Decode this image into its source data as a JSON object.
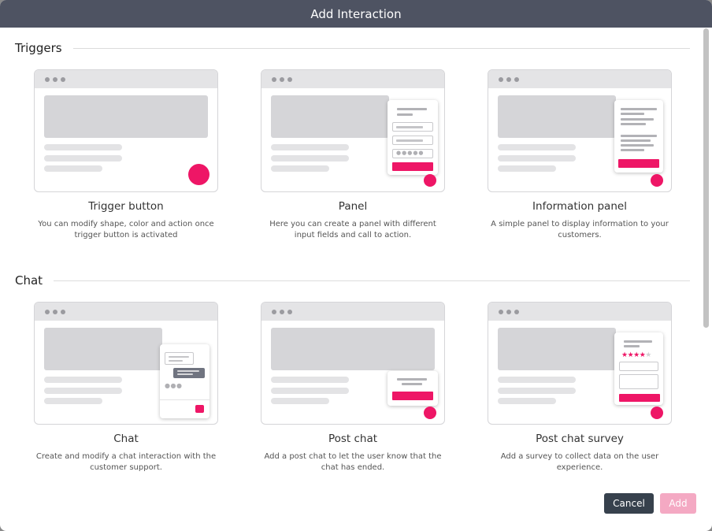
{
  "dialog": {
    "title": "Add Interaction"
  },
  "sections": {
    "triggers": {
      "title": "Triggers",
      "cards": {
        "trigger_button": {
          "title": "Trigger button",
          "description": "You can modify shape, color and action once trigger button is activated"
        },
        "panel": {
          "title": "Panel",
          "description": "Here you can create a panel with different input fields and call to action."
        },
        "information_panel": {
          "title": "Information panel",
          "description": "A simple panel to display information to your customers."
        }
      }
    },
    "chat": {
      "title": "Chat",
      "cards": {
        "chat": {
          "title": "Chat",
          "description": "Create and modify a chat interaction with the customer support."
        },
        "post_chat": {
          "title": "Post chat",
          "description": "Add a post chat to let the user know that the chat has ended."
        },
        "post_chat_survey": {
          "title": "Post chat survey",
          "description": "Add a survey to collect data on the user experience."
        }
      }
    }
  },
  "footer": {
    "cancel_label": "Cancel",
    "add_label": "Add"
  },
  "icons": {
    "window_dots": "three-dots-icon",
    "rating": "star-icon"
  },
  "colors": {
    "accent": "#ee1666",
    "title_bar": "#4e5362",
    "cancel_button": "#37414d",
    "add_button_disabled": "#f4a9c3"
  },
  "survey_rating": {
    "filled_stars": 4,
    "total_stars": 5
  }
}
